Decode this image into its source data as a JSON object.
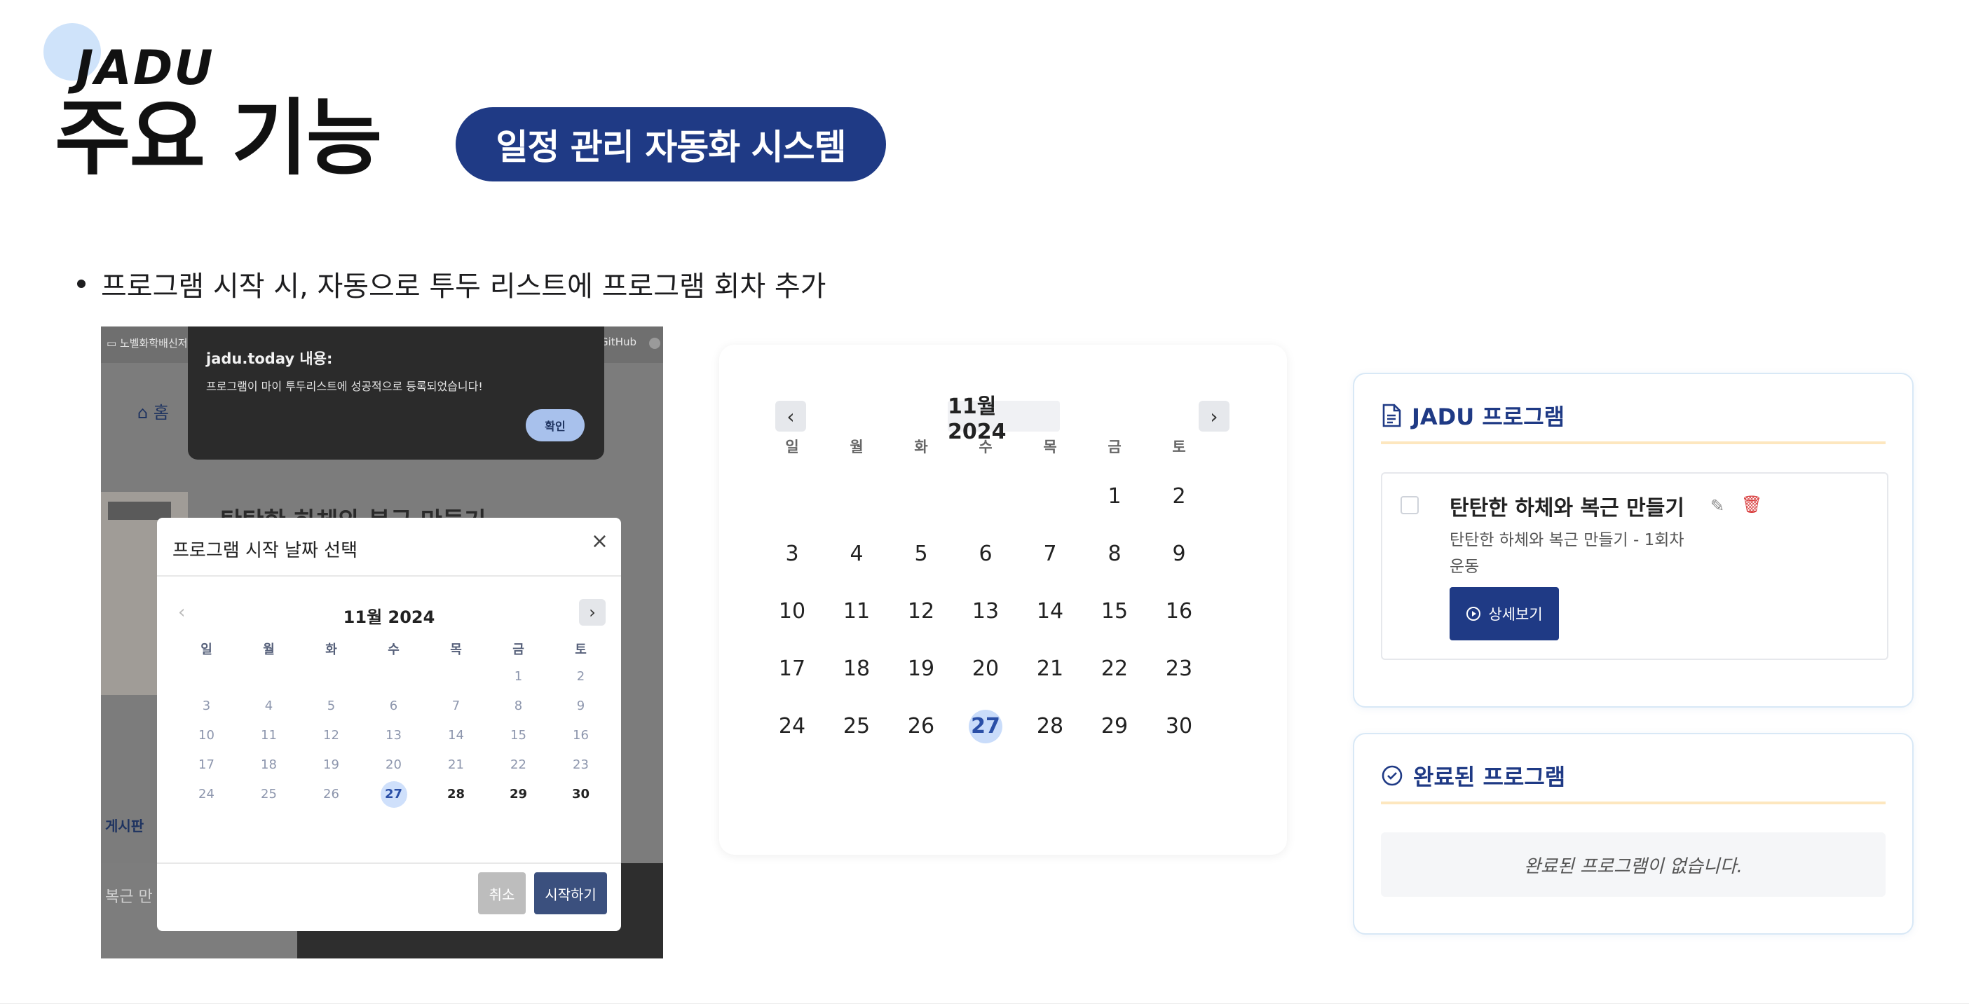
{
  "header": {
    "brand": "JADU",
    "title": "주요 기능",
    "badge": "일정 관리 자동화 시스템",
    "bullet": "프로그램 시작 시, 자동으로 투두 리스트에 프로그램 회차 추가"
  },
  "screenshot": {
    "bookmark": "노벨화학배신저",
    "github": "GitHub",
    "nav_home": "홈",
    "bg_title": "탄탄한 하체와 복근 만들기",
    "board": "게시판",
    "bg_sub": "복근 만",
    "alert": {
      "title": "jadu.today 내용:",
      "message": "프로그램이 마이 투두리스트에 성공적으로 등록되었습니다!",
      "confirm": "확인"
    },
    "modal": {
      "title": "프로그램 시작 날짜 선택",
      "close": "×",
      "month": "11월 2024",
      "prev": "‹",
      "next": "›",
      "weekdays": [
        "일",
        "월",
        "화",
        "수",
        "목",
        "금",
        "토"
      ],
      "days": [
        "",
        "",
        "",
        "",
        "",
        "1",
        "2",
        "3",
        "4",
        "5",
        "6",
        "7",
        "8",
        "9",
        "10",
        "11",
        "12",
        "13",
        "14",
        "15",
        "16",
        "17",
        "18",
        "19",
        "20",
        "21",
        "22",
        "23",
        "24",
        "25",
        "26",
        "27",
        "28",
        "29",
        "30"
      ],
      "selected": "27",
      "cancel": "취소",
      "start": "시작하기"
    }
  },
  "calendar": {
    "month": "11월 2024",
    "prev": "‹",
    "next": "›",
    "weekdays": [
      "일",
      "월",
      "화",
      "수",
      "목",
      "금",
      "토"
    ],
    "days": [
      "",
      "",
      "",
      "",
      "",
      "1",
      "2",
      "3",
      "4",
      "5",
      "6",
      "7",
      "8",
      "9",
      "10",
      "11",
      "12",
      "13",
      "14",
      "15",
      "16",
      "17",
      "18",
      "19",
      "20",
      "21",
      "22",
      "23",
      "24",
      "25",
      "26",
      "27",
      "28",
      "29",
      "30"
    ],
    "selected": "27"
  },
  "programs": {
    "heading": "JADU 프로그램",
    "item_title": "탄탄한 하체와 복근 만들기",
    "item_desc": "탄탄한 하체와 복근 만들기 - 1회차 운동",
    "detail_button": "상세보기",
    "edit_icon": "✎",
    "delete_icon": "🗑"
  },
  "completed": {
    "heading": "완료된 프로그램",
    "empty": "완료된 프로그램이 없습니다."
  },
  "colors": {
    "accent": "#1f3a85",
    "selected_day": "#c9dcfa",
    "divider": "#fde7bf"
  }
}
